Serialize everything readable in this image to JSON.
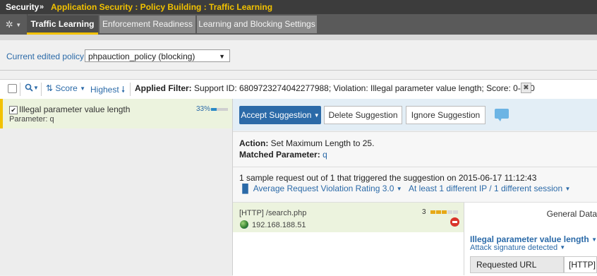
{
  "titlebar": {
    "section": "Security",
    "separator": "»",
    "path": "Application Security : Policy Building : Traffic Learning"
  },
  "tabs": [
    {
      "label": "Traffic Learning",
      "active": true
    },
    {
      "label": "Enforcement Readiness",
      "active": false
    },
    {
      "label": "Learning and Blocking Settings",
      "active": false
    }
  ],
  "policy": {
    "label": "Current edited policy",
    "selected": "phpauction_policy (blocking)"
  },
  "toolbar": {
    "score_sort": "Score",
    "order": "Highest",
    "applied_filter_label": "Applied Filter:",
    "applied_filter_value": "Support ID: 6809723274042277988; Violation: Illegal parameter value length; Score: 0-100"
  },
  "suggestion": {
    "title": "Illegal parameter value length",
    "param_label": "Parameter: q",
    "percent_text": "33%",
    "percent": 0.33
  },
  "actions": {
    "accept": "Accept Suggestion",
    "delete": "Delete Suggestion",
    "ignore": "Ignore Suggestion"
  },
  "details": {
    "action_label": "Action:",
    "action_value": "Set Maximum Length to 25.",
    "matched_label": "Matched Parameter:",
    "matched_value": "q",
    "sample_text": "1 sample request out of 1 that triggered the suggestion on 2015-06-17 11:12:43",
    "rating_text": "Average Request Violation Rating 3.0",
    "distinct_text": "At least 1 different IP / 1 different session"
  },
  "request": {
    "path": "[HTTP] /search.php",
    "ip": "192.168.188.51",
    "rating": "3",
    "rating_value": 3,
    "rating_max": 5
  },
  "general": {
    "heading": "General Data",
    "violation_title": "Illegal parameter value length",
    "attack_label": "Attack signature detected",
    "url_label": "Requested URL",
    "url_value": "[HTTP]"
  },
  "colors": {
    "accent": "#2b6aa8",
    "highlight": "#f2c200",
    "selected_row": "#ecf3de"
  }
}
